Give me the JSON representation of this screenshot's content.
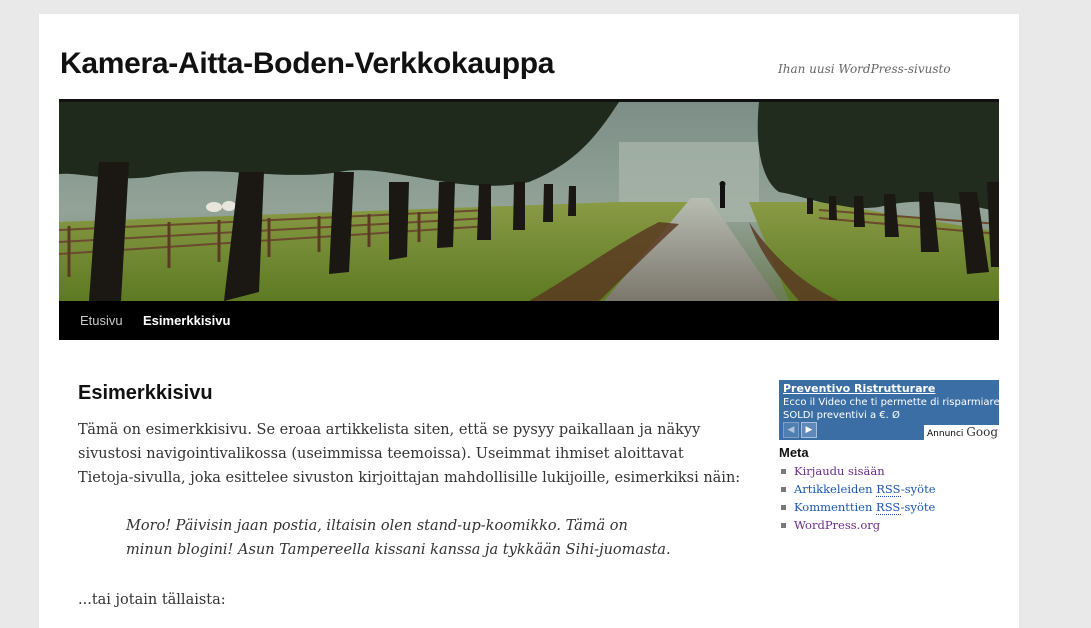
{
  "site": {
    "title": "Kamera-Aitta-Boden-Verkkokauppa",
    "description": "Ihan uusi WordPress-sivusto"
  },
  "nav": {
    "items": [
      {
        "label": "Etusivu",
        "current": false
      },
      {
        "label": "Esimerkkisivu",
        "current": true
      }
    ]
  },
  "article": {
    "title": "Esimerkkisivu",
    "paragraph1": [
      "Tämä on esimerkkisivu. Se eroaa artikkelista siten, että se pysyy paikallaan ja näkyy",
      "sivustosi navigointivalikossa (useimmissa teemoissa). Useimmat ihmiset aloittavat",
      "Tietoja-sivulla, joka esittelee sivuston kirjoittajan mahdollisille lukijoille, esimerkiksi näin:"
    ],
    "quote": [
      "Moro! Päivisin jaan postia, iltaisin olen stand-up-koomikko. Tämä on",
      "minun blogini! Asun Tampereella kissani kanssa ja tykkään Sihi-juomasta."
    ],
    "paragraph2": "...tai jotain tällaista:"
  },
  "ad": {
    "link": "Preventivo Ristrutturare",
    "line1": "Ecco il Video che ti permette di risparmiare",
    "line2": "SOLDI preventivi a €. Ø",
    "prev_icon": "arrow-left-icon",
    "next_icon": "arrow-right-icon",
    "footer_label": "Annunci",
    "footer_brand": "Goog",
    "colors": {
      "background": "#3b6ea5"
    }
  },
  "meta": {
    "title": "Meta",
    "items": [
      {
        "pre": "Kirjaudu sisään",
        "abbr": "",
        "post": "",
        "visited": true
      },
      {
        "pre": "Artikkeleiden ",
        "abbr": "RSS",
        "post": "-syöte",
        "visited": false
      },
      {
        "pre": "Kommenttien ",
        "abbr": "RSS",
        "post": "-syöte",
        "visited": false
      },
      {
        "pre": "WordPress.org",
        "abbr": "",
        "post": "",
        "visited": true
      }
    ]
  },
  "colors": {
    "page_background": "#e9e9e9",
    "nav_background": "#000000",
    "link": "#1b57b1",
    "visited_link": "#6e2c8c"
  }
}
